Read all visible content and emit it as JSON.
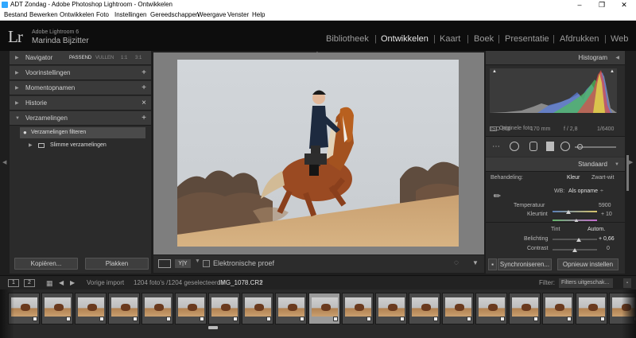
{
  "window": {
    "title": "ADT Zondag - Adobe Photoshop Lightroom - Ontwikkelen",
    "controls": [
      "–",
      "❐",
      "✕"
    ]
  },
  "menu": [
    "Bestand",
    "Bewerken",
    "Ontwikkelen",
    "Foto",
    "Instellingen",
    "Gereedschappen",
    "Weergave",
    "Venster",
    "Help"
  ],
  "identity": {
    "logo": "Lr",
    "version": "Adobe Lightroom 6",
    "user": "Marinda Bijzitter"
  },
  "modules": [
    {
      "label": "Bibliotheek",
      "active": false
    },
    {
      "label": "Ontwikkelen",
      "active": true
    },
    {
      "label": "Kaart",
      "active": false
    },
    {
      "label": "Boek",
      "active": false
    },
    {
      "label": "Presentatie",
      "active": false
    },
    {
      "label": "Afdrukken",
      "active": false
    },
    {
      "label": "Web",
      "active": false
    }
  ],
  "left_panel": {
    "navigator": {
      "label": "Navigator",
      "options": [
        "PASSEND",
        "VULLEN",
        "1:1",
        "3:1"
      ]
    },
    "sections": [
      {
        "label": "Voorinstellingen",
        "ctl": "+"
      },
      {
        "label": "Momentopnamen",
        "ctl": "+"
      },
      {
        "label": "Historie",
        "ctl": "×"
      },
      {
        "label": "Verzamelingen",
        "ctl": "+"
      }
    ],
    "collections": [
      {
        "label": "Verzamelingen filteren"
      },
      {
        "label": "Slimme verzamelingen"
      }
    ],
    "copy_button": "Kopiëren...",
    "paste_button": "Plakken"
  },
  "toolbar": {
    "softproof_label": "Elektronische proef"
  },
  "right_panel": {
    "histogram_label": "Histogram",
    "exif": {
      "iso": "ISO 800",
      "focal": "170 mm",
      "aperture": "f / 2,8",
      "shutter": "1/6400"
    },
    "original_photo": "Originele foto",
    "preset": "Standaard",
    "treatment_label": "Behandeling:",
    "treatment_color": "Kleur",
    "treatment_bw": "Zwart-wit",
    "wb_label": "WB:",
    "wb_value": "Als opname",
    "temperature_label": "Temperatuur",
    "temperature_value": "5900",
    "tint_label": "Kleurtint",
    "tint_value": "+ 10",
    "tone_label": "Tint",
    "auto_label": "Autom.",
    "exposure_label": "Belichting",
    "exposure_value": "+ 0,66",
    "contrast_label": "Contrast",
    "contrast_value": "0",
    "sync_button": "Synchroniseren...",
    "reset_button": "Opnieuw instellen"
  },
  "filmstrip_bar": {
    "page1": "1",
    "page2": "2",
    "source": "Vorige import",
    "count": "1204 foto's /1204 geselecteerd /",
    "filename": "IMG_1078.CR2",
    "filter_label": "Filter:",
    "filter_value": "Filters uitgeschak..."
  },
  "filmstrip": {
    "thumb_count": 19,
    "selected_index": 9
  }
}
